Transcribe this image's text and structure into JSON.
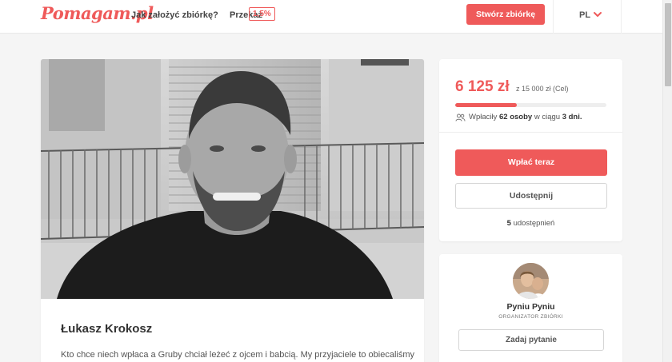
{
  "header": {
    "logo": "Pomagam.pl",
    "nav_how": "Jak założyć zbiórkę?",
    "nav_transfer": "Przekaż",
    "transfer_badge": "1,5%",
    "create_button": "Stwórz zbiórkę",
    "language": "PL"
  },
  "campaign": {
    "title": "Łukasz Krokosz",
    "description": "Kto chce niech wpłaca a Gruby chciał leżeć z ojcem i babcią. My przyjaciele to obiecaliśmy"
  },
  "stats": {
    "raised": "6 125 zł",
    "goal": "z 15 000 zł (Cel)",
    "progress_fraction": 0.408,
    "donors_prefix": "Wpłaciły",
    "donors_count": "62 osoby",
    "donors_mid": "w ciągu",
    "donors_days": "3 dni.",
    "pay_button": "Wpłać teraz",
    "share_button": "Udostępnij",
    "shares_count": "5",
    "shares_label": "udostępnień"
  },
  "organizer": {
    "name": "Pyniu Pyniu",
    "role": "ORGANIZATOR ZBIÓRKI",
    "ask_button": "Zadaj pytanie"
  },
  "colors": {
    "accent": "#ef5a5a"
  }
}
